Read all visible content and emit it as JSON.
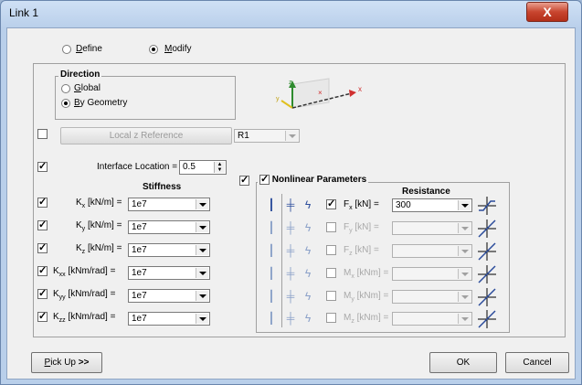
{
  "window": {
    "title": "Link 1",
    "close_label": "X"
  },
  "mode": {
    "define_label": "Define",
    "modify_label": "Modify",
    "selected": "modify"
  },
  "direction": {
    "title": "Direction",
    "global_label": "Global",
    "by_geometry_label": "By Geometry",
    "selected": "by_geometry"
  },
  "local_z": {
    "checked": false,
    "button_label": "Local z Reference",
    "combo_value": "R1"
  },
  "interface": {
    "checked": true,
    "label": "Interface Location =",
    "value": "0.5"
  },
  "stiffness": {
    "header": "Stiffness",
    "rows": [
      {
        "checked": true,
        "label_main": "K",
        "label_sub": "x",
        "unit": " [kN/m] =",
        "value": "1e7"
      },
      {
        "checked": true,
        "label_main": "K",
        "label_sub": "y",
        "unit": " [kN/m] =",
        "value": "1e7"
      },
      {
        "checked": true,
        "label_main": "K",
        "label_sub": "z",
        "unit": " [kN/m] =",
        "value": "1e7"
      },
      {
        "checked": true,
        "label_main": "K",
        "label_sub": "xx",
        "unit": " [kNm/rad] =",
        "value": "1e7"
      },
      {
        "checked": true,
        "label_main": "K",
        "label_sub": "yy",
        "unit": " [kNm/rad] =",
        "value": "1e7"
      },
      {
        "checked": true,
        "label_main": "K",
        "label_sub": "zz",
        "unit": " [kNm/rad] =",
        "value": "1e7"
      }
    ]
  },
  "nonlinear": {
    "outer_checked": true,
    "inner_checked": true,
    "title": "Nonlinear Parameters",
    "resistance_header": "Resistance",
    "rows": [
      {
        "checked": true,
        "enabled": true,
        "label_main": "F",
        "label_sub": "x",
        "unit": " [kN] =",
        "value": "300"
      },
      {
        "checked": false,
        "enabled": false,
        "label_main": "F",
        "label_sub": "y",
        "unit": " [kN] =",
        "value": ""
      },
      {
        "checked": false,
        "enabled": false,
        "label_main": "F",
        "label_sub": "z",
        "unit": " [kN] =",
        "value": ""
      },
      {
        "checked": false,
        "enabled": false,
        "label_main": "M",
        "label_sub": "x",
        "unit": " [kNm] =",
        "value": ""
      },
      {
        "checked": false,
        "enabled": false,
        "label_main": "M",
        "label_sub": "y",
        "unit": " [kNm] =",
        "value": ""
      },
      {
        "checked": false,
        "enabled": false,
        "label_main": "M",
        "label_sub": "z",
        "unit": " [kNm] =",
        "value": ""
      }
    ]
  },
  "axes_icon": {
    "z": "z",
    "x": "x",
    "y": "y"
  },
  "footer": {
    "pickup_label": "Pick Up >>",
    "ok_label": "OK",
    "cancel_label": "Cancel"
  }
}
